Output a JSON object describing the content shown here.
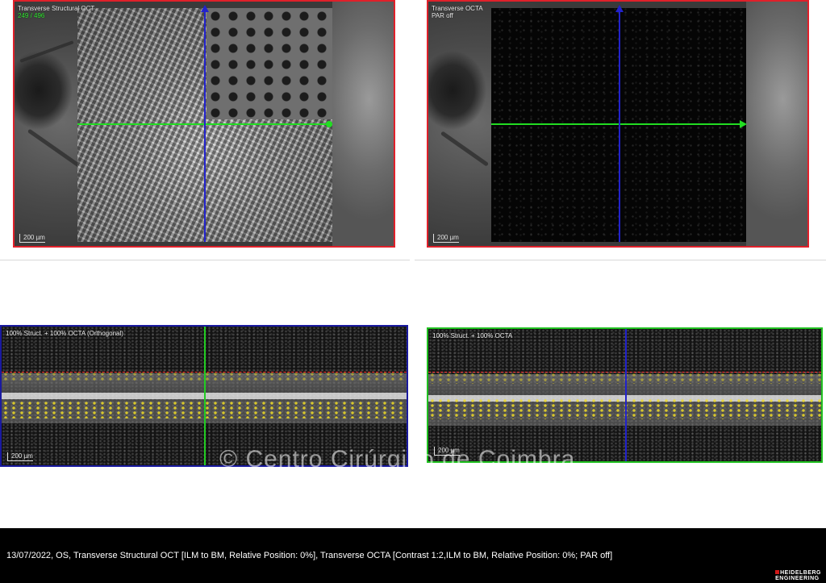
{
  "top_left": {
    "title": "Transverse Structural OCT",
    "counter": "249 / 496",
    "scale": "200 µm"
  },
  "top_right": {
    "title": "Transverse OCTA",
    "subtitle": "PAR off",
    "scale": "200 µm"
  },
  "bottom_left": {
    "title": "100% Struct. + 100% OCTA (Orthogonal)",
    "scale": "200 µm"
  },
  "bottom_right": {
    "title": "100% Struct. + 100% OCTA",
    "scale": "200 µm"
  },
  "watermark": "© Centro Cirúrgico de Coimbra",
  "footer": {
    "info": "13/07/2022, OS, Transverse Structural OCT [ILM to BM, Relative Position: 0%], Transverse OCTA [Contrast 1:2,ILM to BM, Relative Position: 0%; PAR off]",
    "logo_line1": "HEIDELBERG",
    "logo_line2": "ENGINEERING"
  },
  "colors": {
    "top_frame": "#e0202a",
    "bottom_left_frame": "#1a1aa0",
    "bottom_right_frame": "#20c020",
    "horizontal_line": "#22dd22",
    "vertical_line": "#2222cc"
  }
}
